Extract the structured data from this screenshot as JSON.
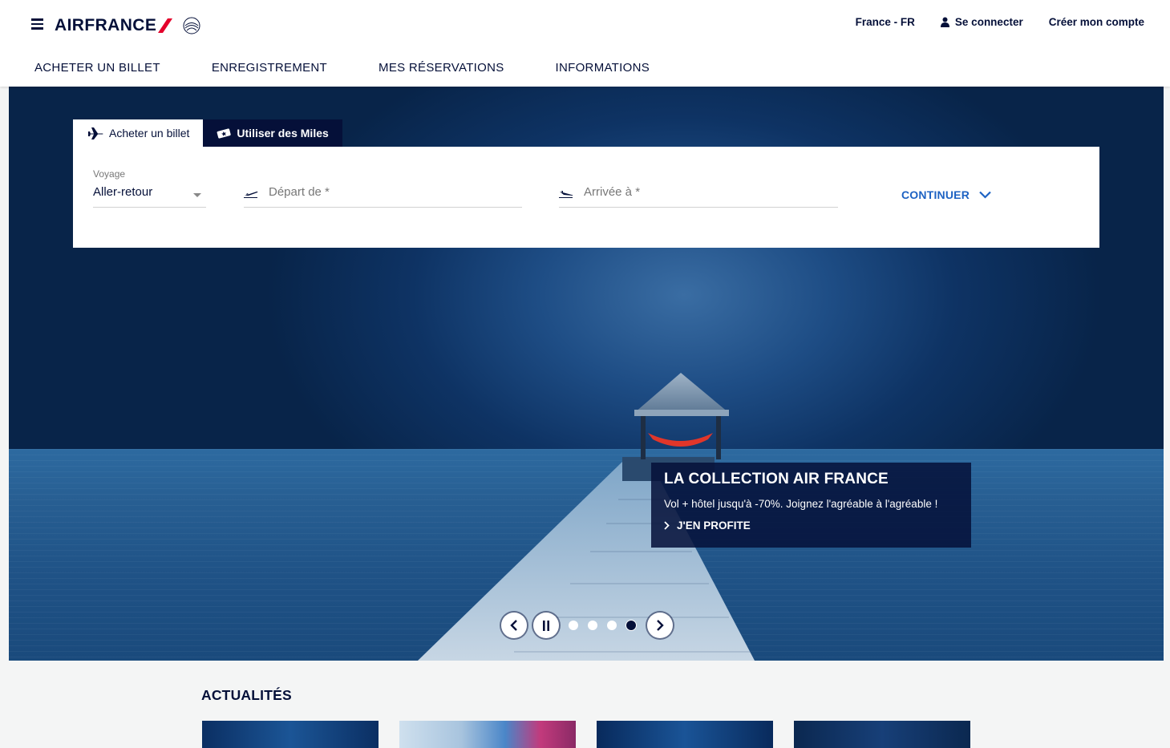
{
  "header": {
    "logo_text": "AIRFRANCE",
    "language": "France - FR",
    "login": "Se connecter",
    "create_account": "Créer mon compte"
  },
  "nav": {
    "items": [
      {
        "label": "ACHETER UN BILLET"
      },
      {
        "label": "ENREGISTREMENT"
      },
      {
        "label": "MES RÉSERVATIONS"
      },
      {
        "label": "INFORMATIONS"
      }
    ]
  },
  "booking": {
    "tabs": [
      {
        "label": "Acheter un billet",
        "icon": "plane-icon",
        "active": true
      },
      {
        "label": "Utiliser des Miles",
        "icon": "ticket-icon",
        "active": false
      }
    ],
    "voyage_label": "Voyage",
    "voyage_value": "Aller-retour",
    "depart_placeholder": "Départ de *",
    "arrivee_placeholder": "Arrivée à *",
    "continue_label": "CONTINUER"
  },
  "promo": {
    "title": "LA COLLECTION AIR FRANCE",
    "text": "Vol + hôtel jusqu'à -70%. Joignez l'agréable à l'agréable !",
    "link": "J'EN PROFITE"
  },
  "carousel": {
    "dots": 4,
    "active_dot": 4
  },
  "news": {
    "title": "ACTUALITÉS"
  },
  "colors": {
    "brand_navy": "#051039",
    "brand_red": "#e4002b",
    "link_blue": "#1d62c3"
  }
}
